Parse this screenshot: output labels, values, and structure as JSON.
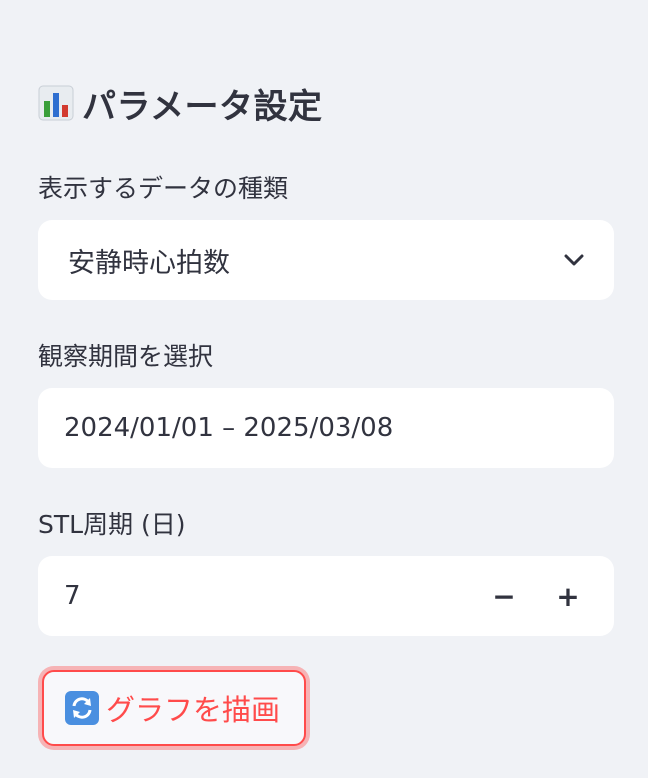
{
  "sidebar": {
    "title": "パラメータ設定",
    "title_icon": "bar-chart-emoji-icon",
    "data_type": {
      "label": "表示するデータの種類",
      "selected": "安静時心拍数",
      "icon": "chevron-down-icon"
    },
    "period": {
      "label": "観察期間を選択",
      "value": "2024/01/01 – 2025/03/08"
    },
    "stl_period": {
      "label": "STL周期 (日)",
      "value": "7",
      "decrement": "−",
      "increment": "+"
    },
    "draw_button": {
      "label": "グラフを描画",
      "icon": "refresh-emoji-icon"
    }
  },
  "colors": {
    "background": "#f0f2f6",
    "field_background": "#ffffff",
    "text": "#31333f",
    "accent": "#ff4b4b"
  }
}
